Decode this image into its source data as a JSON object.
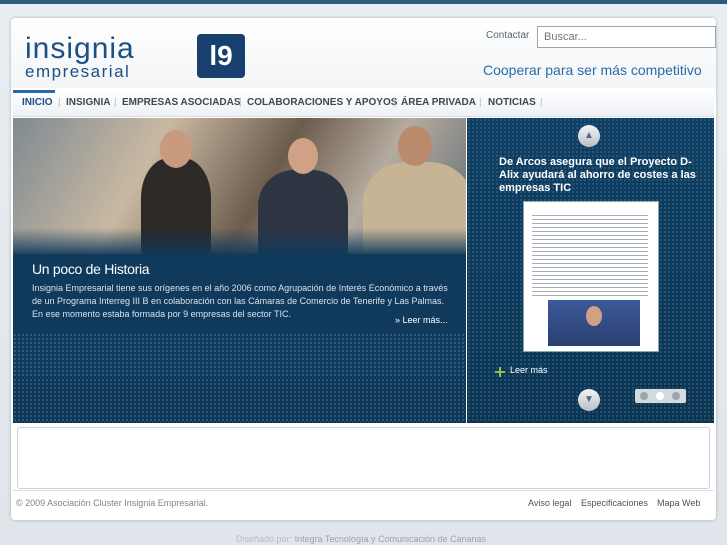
{
  "header": {
    "logo_word1": "insignia",
    "logo_word2": "empresarial",
    "logo_mark": "l9",
    "contact_label": "Contactar",
    "search_placeholder": "Buscar...",
    "slogan": "Cooperar para ser más competitivo"
  },
  "nav": {
    "items": [
      {
        "label": "INICIO",
        "active": true
      },
      {
        "label": "INSIGNIA"
      },
      {
        "label": "EMPRESAS ASOCIADAS"
      },
      {
        "label": "COLABORACIONES Y APOYOS"
      },
      {
        "label": "ÁREA PRIVADA"
      },
      {
        "label": "NOTICIAS"
      }
    ],
    "separator": "|"
  },
  "hero": {
    "title": "Un poco de Historia",
    "text": "Insignia Empresarial tiene sus orígenes en el año 2006  como Agrupación de Interés Económico  a través de un Programa Interreg III B en colaboración con las Cámaras de Comercio de Tenerife y Las Palmas.  En ese momento estaba formada por 9 empresas del sector TIC.",
    "more_label": "» Leer más..."
  },
  "news": {
    "up_arrow": "▲",
    "down_arrow": "▼",
    "title": "De Arcos asegura que el Proyecto D-Alix ayudará al ahorro de costes a las empresas TIC",
    "more_label": "Leer más"
  },
  "footer": {
    "copyright": "© 2009 Asociación Cluster Insignia Empresarial.",
    "links": [
      "Aviso legal",
      "Especificaciones",
      "Mapa Web"
    ],
    "designed_prefix": "Diseñado por",
    "designed_by": "Integra Tecnología y Comunicación de Canarias"
  },
  "colors": {
    "brand": "#1c4f86",
    "hero_bg": "#103a5c",
    "accent_green": "#8cc63f"
  }
}
